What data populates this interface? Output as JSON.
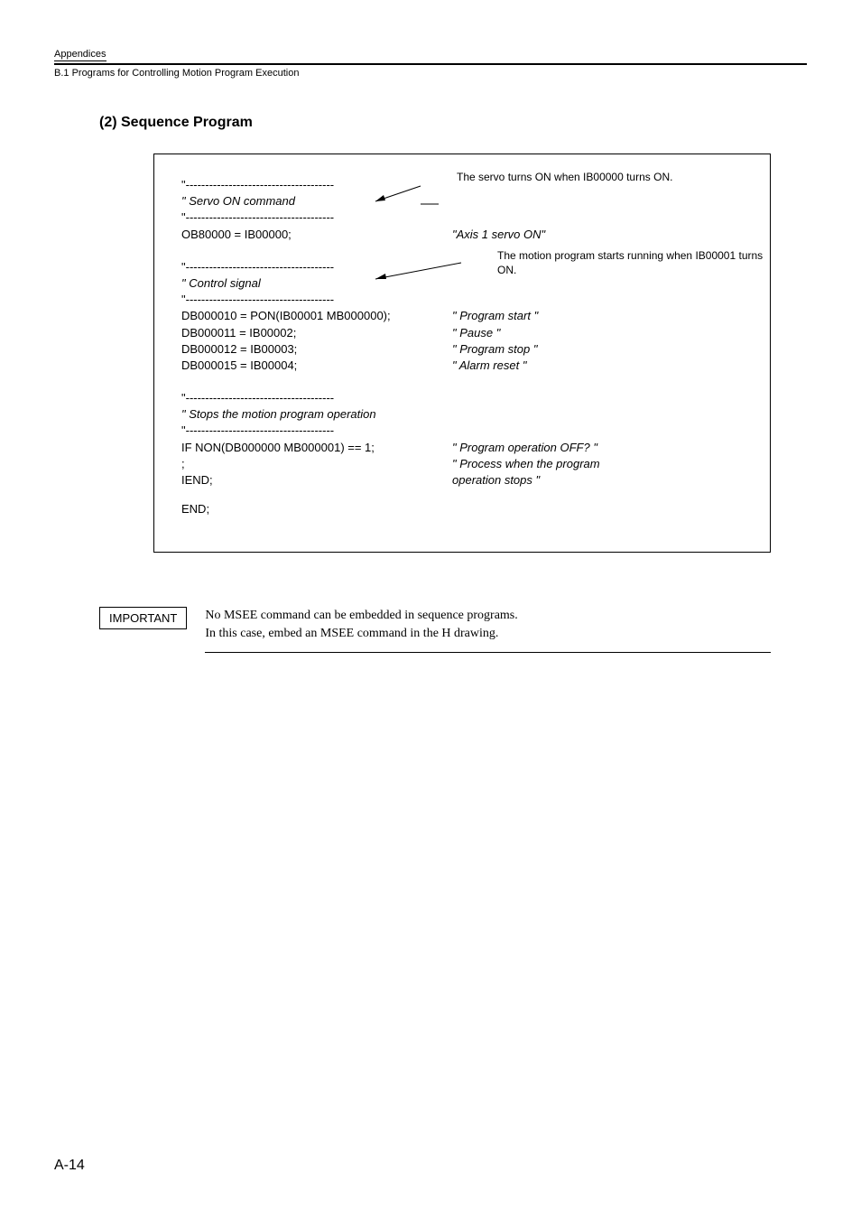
{
  "header": {
    "appendix": "Appendices",
    "section_path": "B.1  Programs for Controlling Motion Program Execution"
  },
  "heading": "(2) Sequence Program",
  "callouts": {
    "servo_on": "The servo turns ON when IB00000 turns ON.",
    "control_signal": "The motion program starts running when IB00001 turns ON."
  },
  "code": {
    "block1_dash1": "\"--------------------------------------",
    "block1_label": "\"    Servo ON command",
    "block1_dash2": "\"--------------------------------------",
    "block1_line1_left": "OB80000 = IB00000;",
    "block1_line1_right": "\"Axis 1 servo ON\"",
    "block2_dash1": "\"--------------------------------------",
    "block2_label": "\"    Control signal",
    "block2_dash2": "\"--------------------------------------",
    "block2_line1_left": "DB000010 = PON(IB00001 MB000000);",
    "block2_line1_right": "\" Program start \"",
    "block2_line2_left": "DB000011 = IB00002;",
    "block2_line2_right": "\" Pause \"",
    "block2_line3_left": "DB000012 = IB00003;",
    "block2_line3_right": "\" Program stop \"",
    "block2_line4_left": "DB000015 = IB00004;",
    "block2_line4_right": "\" Alarm reset  \"",
    "block3_dash1": "\"--------------------------------------",
    "block3_label": "\"    Stops the motion program operation",
    "block3_dash2": "\"--------------------------------------",
    "block3_line1_left": "IF NON(DB000000 MB000001) == 1;",
    "block3_line1_right": "\" Program operation OFF? \"",
    "block3_line2_left": ";",
    "block3_line2_right": "\" Process when the program",
    "block3_line3_left": "IEND;",
    "block3_line3_right": "   operation stops \"",
    "block3_end": "END;"
  },
  "important": {
    "label": "IMPORTANT",
    "line1": "No MSEE command can be embedded in sequence programs.",
    "line2": "In this case, embed an MSEE command in the H drawing."
  },
  "page_number": "A-14"
}
